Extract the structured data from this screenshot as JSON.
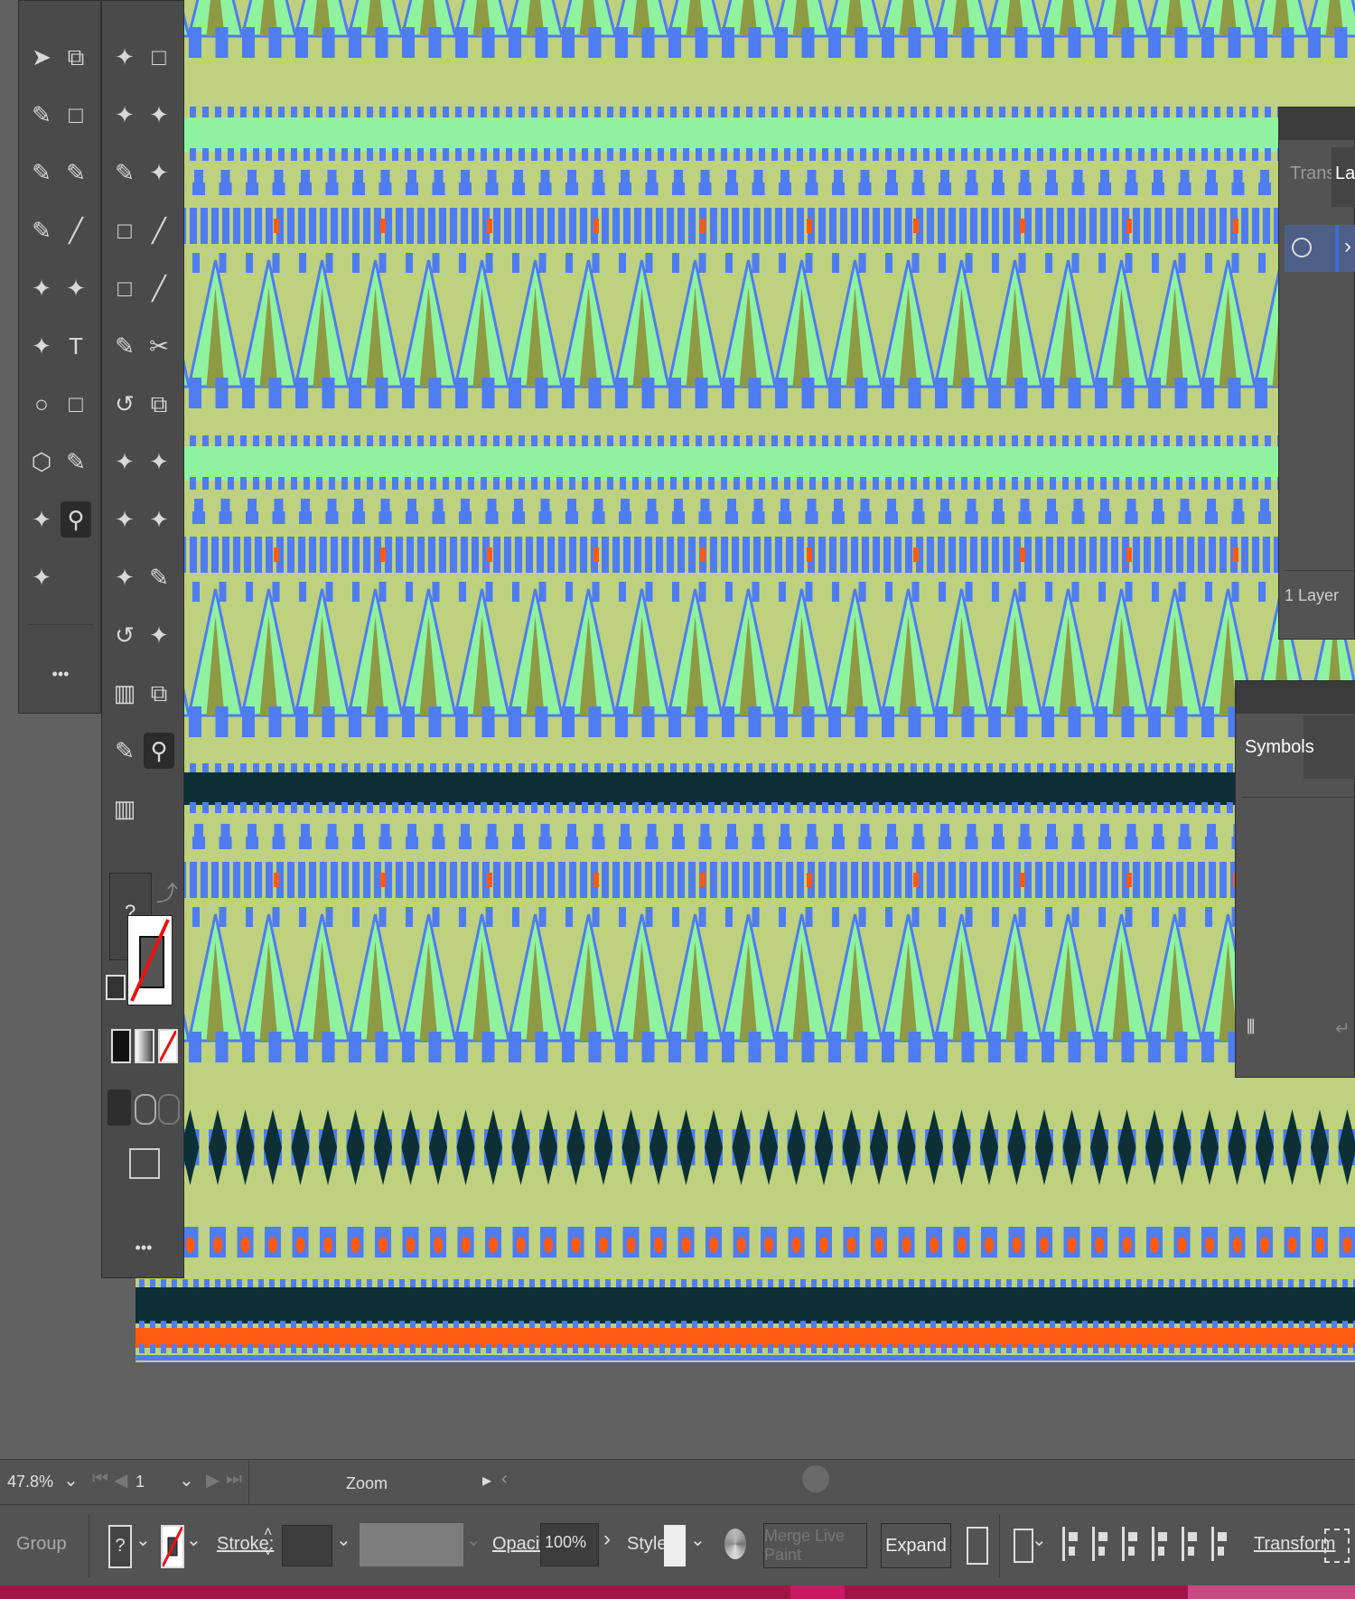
{
  "colors": {
    "workspace": "#616161",
    "ui_panel": "#535353",
    "artboard_olive": "#bdd17e",
    "mint": "#8ff29e",
    "blue": "#4f7cf0",
    "dark_teal": "#0c3036",
    "orange": "#ff5a12",
    "khaki": "#8f9a44",
    "bottom_strip": "#a01446"
  },
  "tools_left": [
    "selection-icon",
    "artboard-icon",
    "paintbrush-icon",
    "direct-selection-icon",
    "pencil-icon",
    "pen-icon",
    "blob-brush-icon",
    "line-icon",
    "shape-builder-icon",
    "reflect-icon",
    "perspective-icon",
    "type-icon",
    "ellipse-icon",
    "rectangle-icon",
    "polygon-icon",
    "pen-tool-icon",
    "width-icon",
    "zoom-icon",
    "gradient-icon"
  ],
  "tools_right": [
    "magic-wand-icon",
    "direct-select-icon",
    "add-anchor-icon",
    "anchor-convert-icon",
    "pen-icon",
    "curvature-icon",
    "direct-select-plus-icon",
    "arc-icon",
    "rounded-rect-icon",
    "line-segment-icon",
    "pencil-icon",
    "scissors-icon",
    "rotate-icon",
    "scale-icon",
    "warp-icon",
    "puppet-warp-icon",
    "free-transform-icon",
    "live-paint-icon",
    "symbol-sprayer-icon",
    "eraser-icon",
    "rotate-view-icon",
    "spray-icon",
    "column-graph-icon",
    "crop-icon",
    "eyedropper-icon",
    "zoom-icon",
    "bar-graph-icon"
  ],
  "toolbar": {
    "more_label": "•••"
  },
  "fill_stroke": {
    "fill_label": "?"
  },
  "layers_panel": {
    "tab_transform": "Transf",
    "tab_layers": "Laye",
    "layer_count": "1 Layer"
  },
  "symbols_panel": {
    "tab_label": "Symbols"
  },
  "status_bar": {
    "zoom": "47.8%",
    "artboard_number": "1",
    "status_label": "Zoom"
  },
  "control_bar": {
    "selection_type": "Group",
    "fill_value": "?",
    "stroke_label": "Stroke:",
    "opacity_label": "Opacity:",
    "opacity_value": "100%",
    "style_label": "Style:",
    "merge_live_paint_label": "Merge Live Paint",
    "expand_label": "Expand",
    "transform_label": "Transform"
  }
}
